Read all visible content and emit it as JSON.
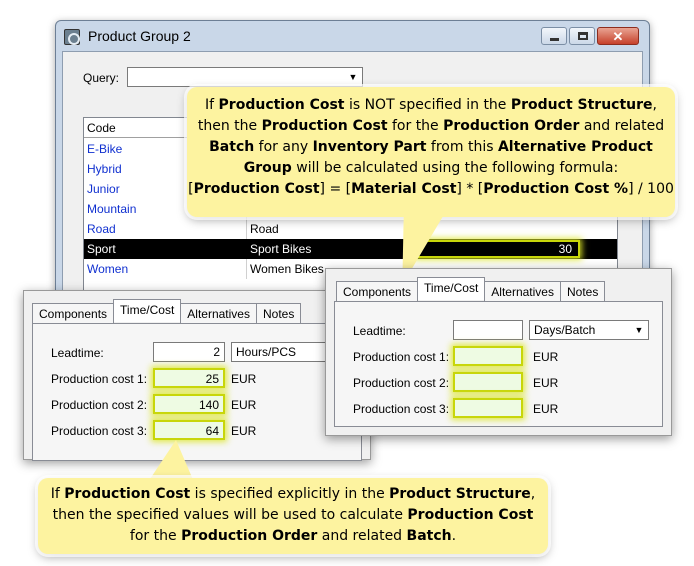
{
  "window": {
    "title": "Product Group 2",
    "controls": [
      "—",
      "☐",
      "✕"
    ]
  },
  "query": {
    "label": "Query:",
    "value": ""
  },
  "list": {
    "header_code": "Code",
    "rows": [
      {
        "code": "E-Bike",
        "desc": ""
      },
      {
        "code": "Hybrid",
        "desc": ""
      },
      {
        "code": "Junior",
        "desc": ""
      },
      {
        "code": "Mountain",
        "desc": ""
      },
      {
        "code": "Road",
        "desc": "Road"
      },
      {
        "code": "Sport",
        "desc": "Sport Bikes",
        "value": "30"
      },
      {
        "code": "Women",
        "desc": "Women Bikes"
      }
    ]
  },
  "callout_top": {
    "l1a": "If ",
    "l1b": "Production Cost",
    "l1c": " is NOT specified in the ",
    "l1d": "Product Structure",
    "l1e": ",",
    "l2a": "then the ",
    "l2b": "Production Cost",
    "l2c": " for the ",
    "l2d": "Production Order",
    "l2e": " and related",
    "l3a": "Batch",
    "l3b": " for any ",
    "l3c": "Inventory Part",
    "l3d": " from this ",
    "l3e": "Alternative Product",
    "l4a": "Group",
    "l4b": " will be calculated using the following formula:",
    "l5a": "[",
    "l5b": "Production Cost",
    "l5c": "] = [",
    "l5d": "Material Cost",
    "l5e": "] * [",
    "l5f": "Production Cost %",
    "l5g": "] / 100"
  },
  "callout_bottom": {
    "l1a": "If ",
    "l1b": "Production Cost",
    "l1c": " is specified explicitly in the ",
    "l1d": "Product Structure",
    "l1e": ",",
    "l2a": "then the specified values will be used to calculate ",
    "l2b": "Production Cost",
    "l3a": "for the ",
    "l3b": "Production Order",
    "l3c": " and related ",
    "l3d": "Batch",
    "l3e": "."
  },
  "tabs": [
    "Components",
    "Time/Cost",
    "Alternatives",
    "Notes"
  ],
  "left_panel": {
    "leadtime_label": "Leadtime:",
    "leadtime_value": "2",
    "leadtime_unit": "Hours/PCS",
    "costs": [
      {
        "label": "Production cost 1:",
        "value": "25",
        "unit": "EUR"
      },
      {
        "label": "Production cost 2:",
        "value": "140",
        "unit": "EUR"
      },
      {
        "label": "Production cost 3:",
        "value": "64",
        "unit": "EUR"
      }
    ]
  },
  "right_panel": {
    "leadtime_label": "Leadtime:",
    "leadtime_value": "",
    "leadtime_unit": "Days/Batch",
    "costs": [
      {
        "label": "Production cost 1:",
        "value": "",
        "unit": "EUR"
      },
      {
        "label": "Production cost 2:",
        "value": "",
        "unit": "EUR"
      },
      {
        "label": "Production cost 3:",
        "value": "",
        "unit": "EUR"
      }
    ]
  }
}
